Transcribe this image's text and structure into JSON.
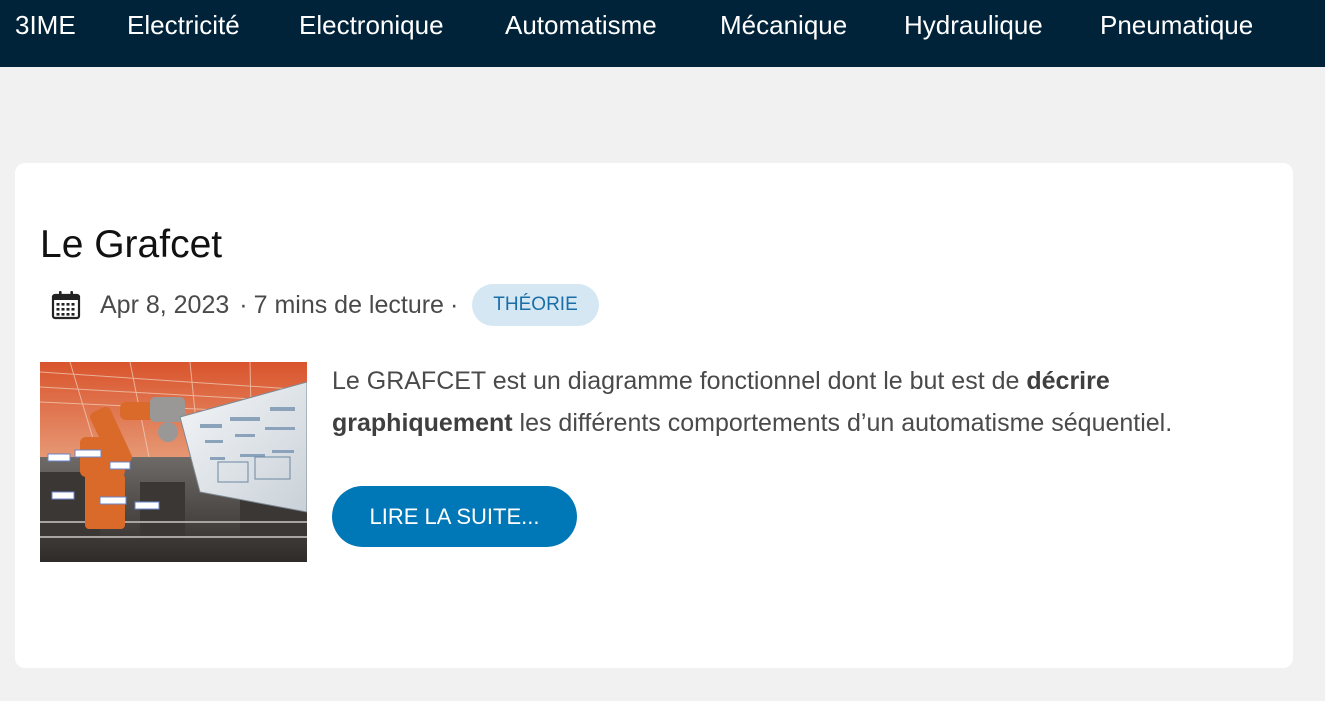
{
  "nav": {
    "items": [
      {
        "label": "3IME"
      },
      {
        "label": "Electricité"
      },
      {
        "label": "Electronique"
      },
      {
        "label": "Automatisme"
      },
      {
        "label": "Mécanique"
      },
      {
        "label": "Hydraulique"
      },
      {
        "label": "Pneumatique"
      }
    ]
  },
  "post": {
    "title": "Le Grafcet",
    "date": "Apr 8, 2023",
    "separator": "·",
    "reading_time": "7 mins de lecture",
    "category": "THÉORIE",
    "excerpt": {
      "part1": "Le GRAFCET est un diagramme fonctionnel dont le but est de ",
      "bold": "décrire graphiquement",
      "part2": " les différents comportements d’un automatisme séquentiel."
    },
    "read_more_label": "LIRE LA SUITE..."
  },
  "icons": {
    "date": "calendar-icon"
  },
  "colors": {
    "nav_background": "#00233a",
    "page_background": "#f1f1f2",
    "card_background": "#ffffff",
    "badge_background": "#d6e7f4",
    "badge_text": "#1a6ea8",
    "button_background": "#0077b6",
    "button_text": "#ffffff"
  }
}
